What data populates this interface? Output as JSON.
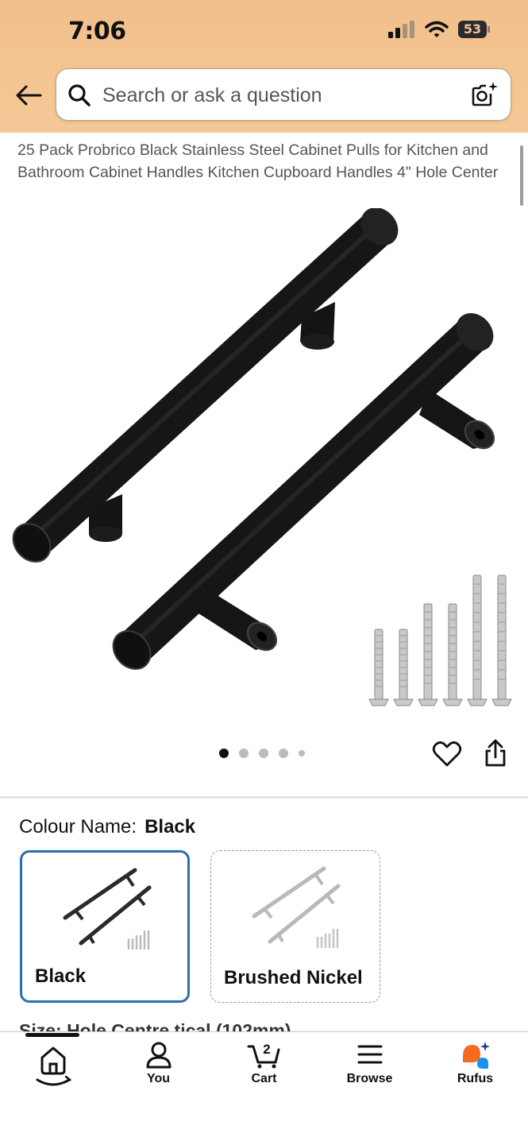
{
  "status_bar": {
    "time": "7:06",
    "battery": "53"
  },
  "search": {
    "placeholder": "Search or ask a question"
  },
  "product": {
    "title": "25 Pack Probrico Black Stainless Steel Cabinet Pulls for Kitchen and Bathroom Cabinet Handles Kitchen Cupboard Handles 4\" Hole Center",
    "image_count": 5,
    "active_image": 0
  },
  "colour": {
    "label": "Colour Name:",
    "selected": "Black",
    "options": [
      {
        "label": "Black",
        "selected": true
      },
      {
        "label": "Brushed Nickel",
        "selected": false
      }
    ]
  },
  "next_section_peek": "Size: Hole Centre tical (102mm)",
  "tabbar": {
    "tabs": [
      {
        "label": "",
        "icon": "home-icon",
        "active": true
      },
      {
        "label": "You",
        "icon": "person-icon"
      },
      {
        "label": "Cart",
        "icon": "cart-icon",
        "badge": "2"
      },
      {
        "label": "Browse",
        "icon": "menu-icon"
      },
      {
        "label": "Rufus",
        "icon": "rufus-icon"
      }
    ]
  },
  "colors": {
    "header_bg": "#f3c290",
    "selected_border": "#2a6fb0",
    "rufus_orange": "#f56b1f",
    "rufus_blue": "#1f8ff0"
  }
}
